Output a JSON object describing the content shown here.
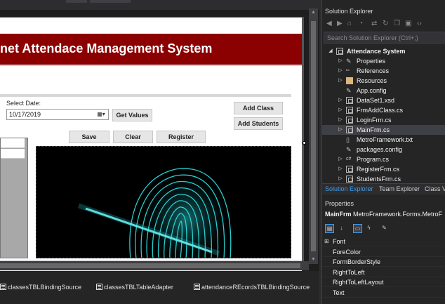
{
  "form": {
    "title": "net Attendace Management System",
    "select_date_label": "Select Date:",
    "date_value": "10/17/2019",
    "date_dropdown_glyph": "▦▾",
    "buttons": {
      "get_values": "Get Values",
      "add_class": "Add Class",
      "add_students": "Add Students",
      "save": "Save",
      "clear": "Clear",
      "register": "Register"
    },
    "resize_grip": "⠿",
    "colors": {
      "banner": "#8b0000",
      "fingerprint_glow": "#29d6d9"
    }
  },
  "tray": {
    "items": [
      {
        "label": "classesTBLBindingSource",
        "icon": "binding-source-icon"
      },
      {
        "label": "classesTBLTableAdapter",
        "icon": "table-adapter-icon"
      },
      {
        "label": "attendanceREcordsTBLBindingSource",
        "icon": "binding-source-icon"
      }
    ]
  },
  "solution_explorer": {
    "title": "Solution Explorer",
    "search_placeholder": "Search Solution Explorer (Ctrl+;)",
    "items": [
      {
        "label": "Attendance System",
        "icon": "project-icon",
        "bold": true,
        "arrow": "◢"
      },
      {
        "label": "Properties",
        "icon": "wrench-icon",
        "arrow": "▷"
      },
      {
        "label": "References",
        "icon": "references-icon",
        "arrow": "▷"
      },
      {
        "label": "Resources",
        "icon": "folder-icon",
        "arrow": "▷"
      },
      {
        "label": "App.config",
        "icon": "config-icon",
        "arrow": ""
      },
      {
        "label": "DataSet1.xsd",
        "icon": "dataset-icon",
        "arrow": "▷"
      },
      {
        "label": "FrmAddClass.cs",
        "icon": "form-icon",
        "arrow": "▷"
      },
      {
        "label": "LoginFrm.cs",
        "icon": "form-icon",
        "arrow": "▷"
      },
      {
        "label": "MainFrm.cs",
        "icon": "form-icon",
        "arrow": "▷",
        "selected": true
      },
      {
        "label": "MetroFramework.txt",
        "icon": "text-file-icon",
        "arrow": ""
      },
      {
        "label": "packages.config",
        "icon": "config-icon",
        "arrow": ""
      },
      {
        "label": "Program.cs",
        "icon": "csharp-icon",
        "arrow": "▷"
      },
      {
        "label": "RegisterFrm.cs",
        "icon": "form-icon",
        "arrow": "▷"
      },
      {
        "label": "StudentsFrm.cs",
        "icon": "form-icon",
        "arrow": "▷"
      }
    ],
    "tabs": [
      "Solution Explorer",
      "Team Explorer",
      "Class Vi"
    ]
  },
  "properties": {
    "title": "Properties",
    "object_name": "MainFrm",
    "object_type": "MetroFramework.Forms.MetroF",
    "rows": [
      {
        "name": "Font",
        "expander": "⊞"
      },
      {
        "name": "ForeColor",
        "expander": ""
      },
      {
        "name": "FormBorderStyle",
        "expander": ""
      },
      {
        "name": "RightToLeft",
        "expander": ""
      },
      {
        "name": "RightToLeftLayout",
        "expander": ""
      },
      {
        "name": "Text",
        "expander": ""
      }
    ]
  }
}
